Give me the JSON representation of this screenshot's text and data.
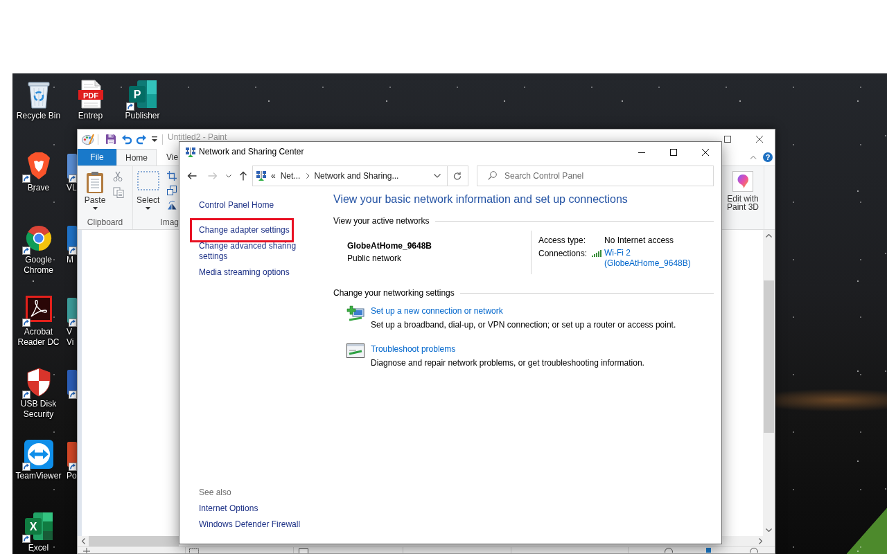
{
  "desktop": {
    "icon_columns": [
      [
        {
          "label": "Recycle Bin",
          "kind": "recycle-bin",
          "shortcut": false
        },
        {
          "label": "Brave",
          "kind": "brave",
          "shortcut": true
        },
        {
          "label": "Google Chrome",
          "kind": "chrome",
          "shortcut": true
        },
        {
          "label": "Acrobat Reader DC",
          "kind": "acrobat",
          "shortcut": true
        },
        {
          "label": "USB Disk Security",
          "kind": "shield",
          "shortcut": true
        },
        {
          "label": "TeamViewer",
          "kind": "teamviewer",
          "shortcut": true
        },
        {
          "label": "Excel",
          "kind": "excel",
          "shortcut": true,
          "icon_text": "X"
        }
      ],
      [
        {
          "label": "Entrep",
          "kind": "pdf",
          "shortcut": false,
          "icon_text": "PDF"
        },
        {
          "label": "VL",
          "kind": "covered",
          "shortcut": true,
          "color": "#5b8fd6"
        },
        {
          "label": "M",
          "kind": "covered",
          "shortcut": true,
          "color": "#1f73c9"
        },
        {
          "label": "V Vi",
          "kind": "covered",
          "shortcut": true,
          "color": "#3c9c9a"
        },
        {
          "kind": "covered",
          "shortcut": true,
          "color": "#2b5eb8"
        },
        {
          "label": "Po",
          "kind": "covered",
          "shortcut": true,
          "color": "#d24726"
        }
      ],
      [
        {
          "label": "Publisher",
          "kind": "publisher",
          "shortcut": true,
          "icon_text": "P"
        }
      ]
    ]
  },
  "paint_window": {
    "title": "Untitled2 - Paint",
    "tabs": [
      {
        "label": "File",
        "kind": "file",
        "selected": false
      },
      {
        "label": "Home",
        "kind": "tab",
        "selected": true
      },
      {
        "label": "Vie",
        "kind": "tab",
        "selected": false
      }
    ],
    "help": "?",
    "ribbon": [
      {
        "kind": "clipboard",
        "label": "Clipboard",
        "button": "Paste"
      },
      {
        "kind": "image",
        "label": "Imag",
        "button": "Select"
      },
      {
        "kind": "paint3d",
        "button": "Edit with Paint 3D"
      }
    ]
  },
  "network_window": {
    "title": "Network and Sharing Center",
    "address": {
      "overflow": "«",
      "crumbs": [
        "Net...",
        "Network and Sharing..."
      ]
    },
    "search": {
      "placeholder": "Search Control Panel"
    },
    "left_pane": {
      "home": "Control Panel Home",
      "tasks": [
        {
          "label": "Change adapter settings",
          "highlighted": true
        },
        {
          "label": "Change advanced sharing settings",
          "highlighted": false
        },
        {
          "label": "Media streaming options",
          "highlighted": false
        }
      ],
      "see_also": {
        "heading": "See also",
        "links": [
          "Internet Options",
          "Windows Defender Firewall"
        ]
      }
    },
    "heading": "View your basic network information and set up connections",
    "active_networks": {
      "heading": "View your active networks",
      "name": "GlobeAtHome_9648B",
      "category": "Public network",
      "access_type_label": "Access type:",
      "access_type": "No Internet access",
      "connections_label": "Connections:",
      "connection": "Wi-Fi 2 (GlobeAtHome_9648B)"
    },
    "settings": {
      "heading": "Change your networking settings",
      "items": [
        {
          "kind": "new-connection",
          "title": "Set up a new connection or network",
          "description": "Set up a broadband, dial-up, or VPN connection; or set up a router or access point."
        },
        {
          "kind": "troubleshoot",
          "title": "Troubleshoot problems",
          "description": "Diagnose and repair network problems, or get troubleshooting information."
        }
      ]
    }
  }
}
